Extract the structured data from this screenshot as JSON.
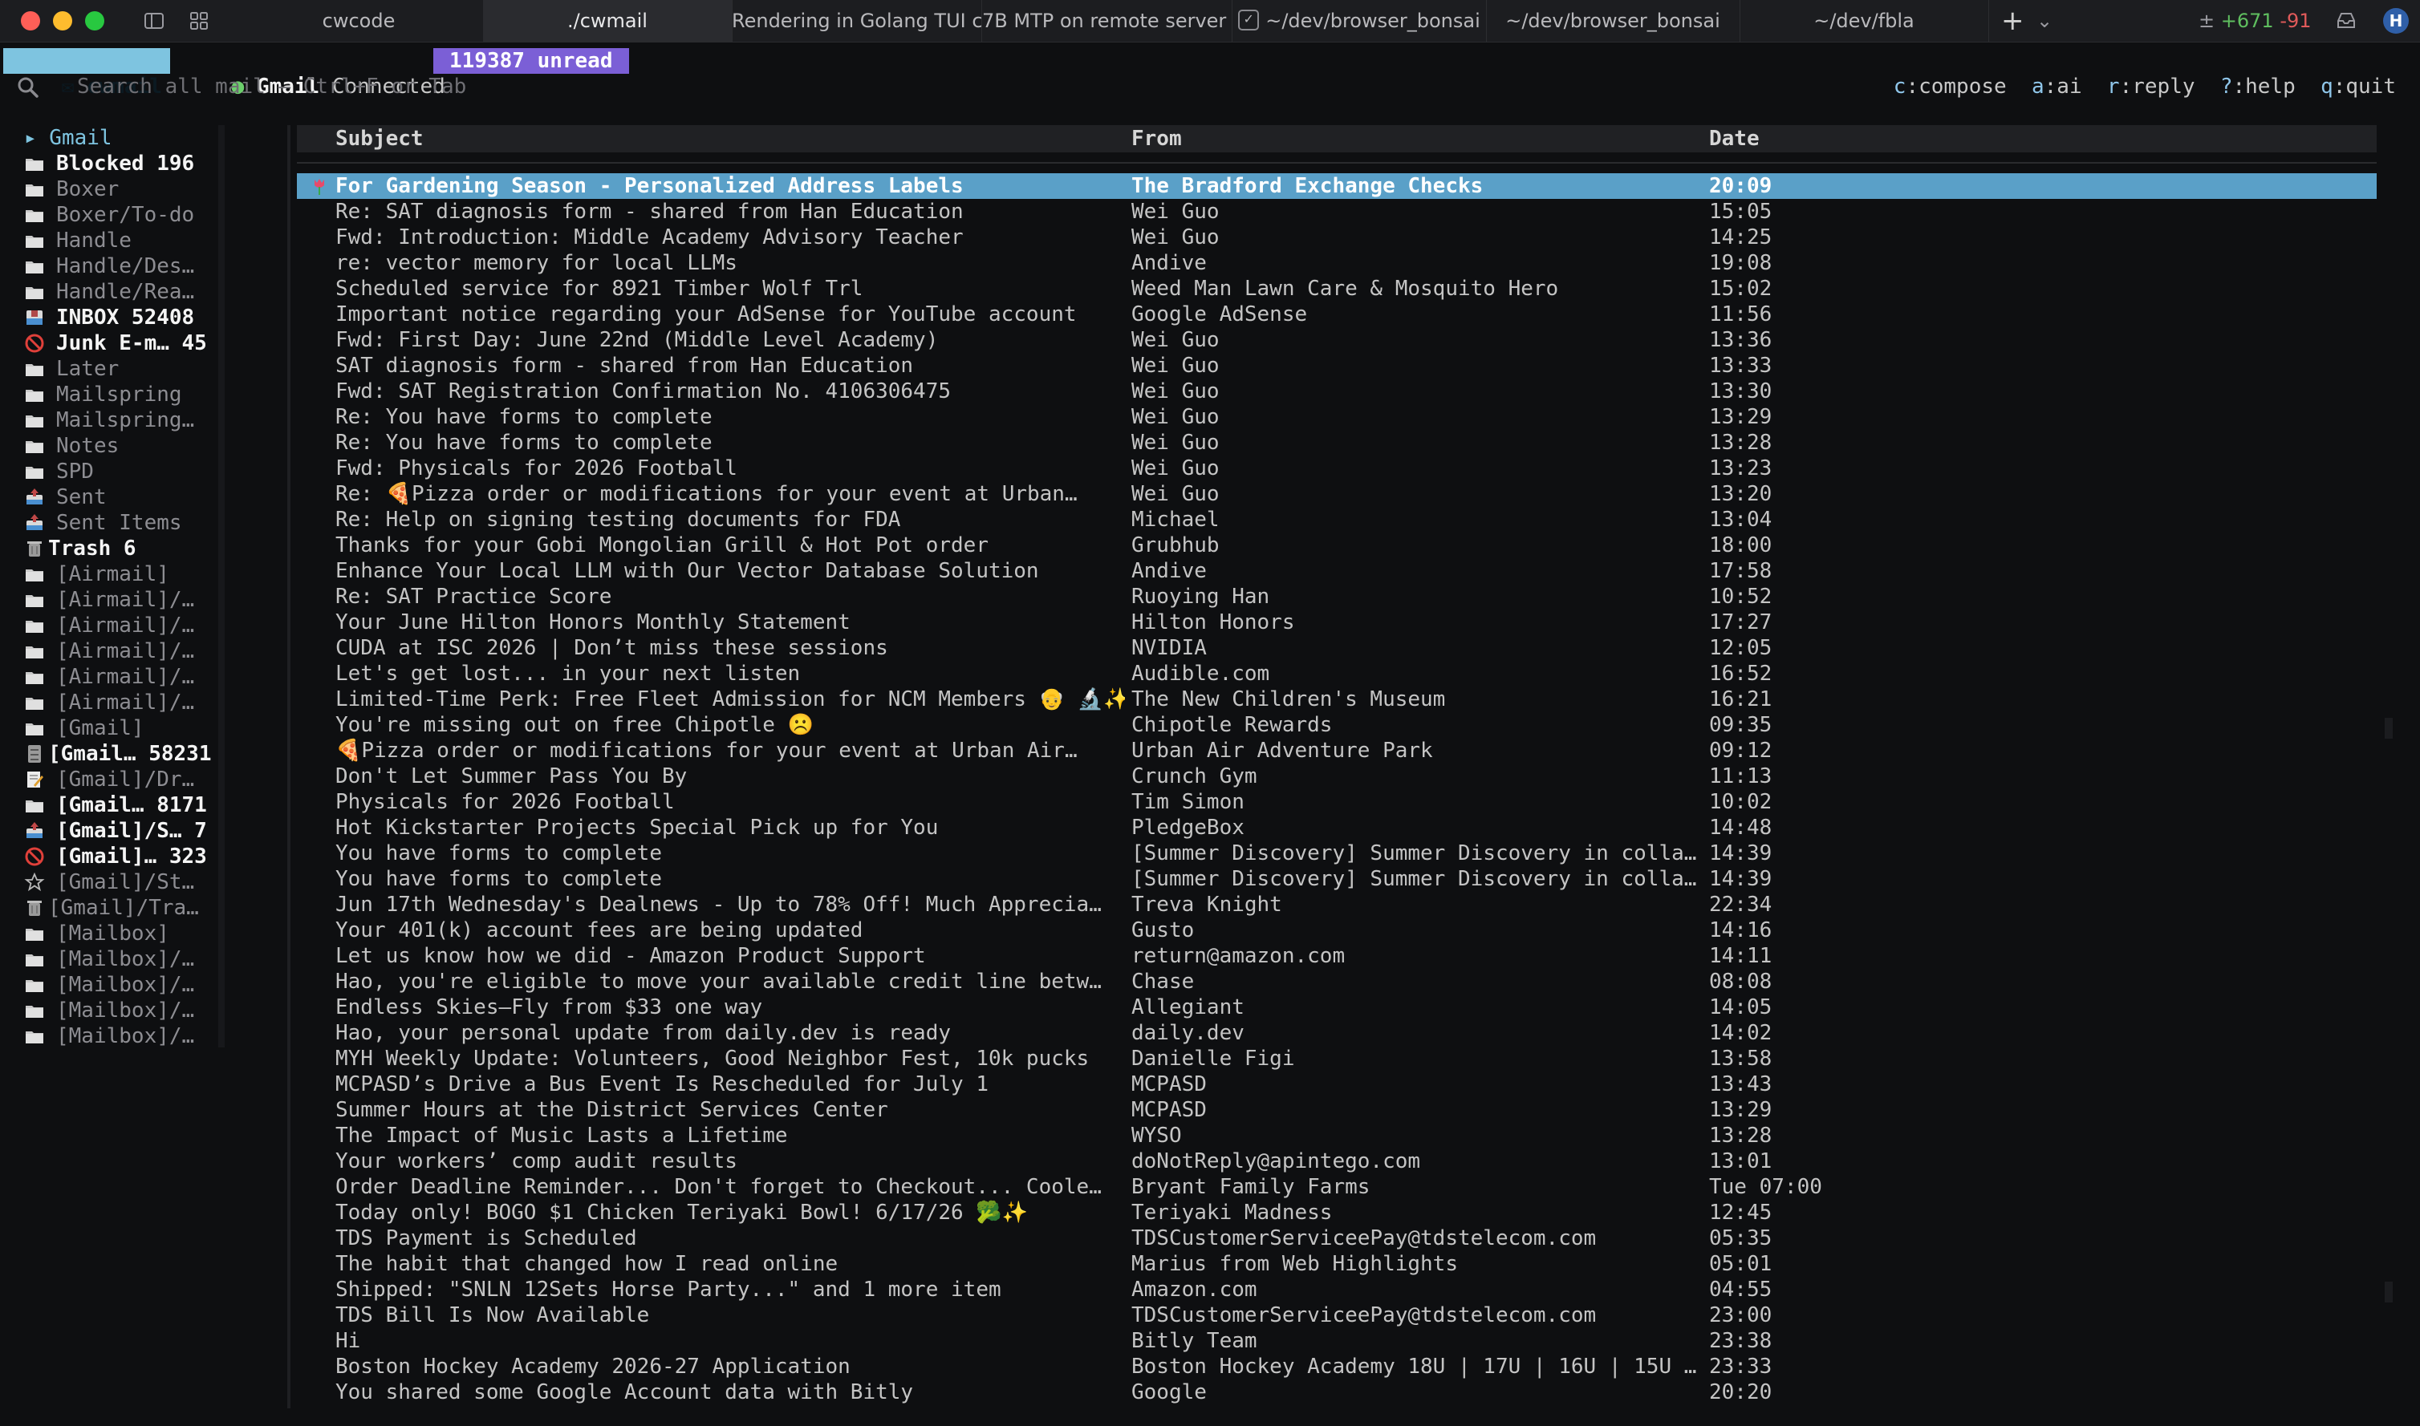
{
  "titlebar": {
    "tabs": [
      {
        "label": "cwcode",
        "active": false
      },
      {
        "label": "./cwmail",
        "active": true
      },
      {
        "label": "Rendering in Golang TUI client",
        "active": false
      },
      {
        "label": "7B MTP on remote server",
        "active": false
      },
      {
        "label": "~/dev/browser_bonsai",
        "active": false,
        "checkbox": true
      },
      {
        "label": "~/dev/browser_bonsai",
        "active": false
      },
      {
        "label": "~/dev/fbla",
        "active": false
      }
    ],
    "new_tab": "+",
    "diff_added": "+671",
    "diff_removed": "-91",
    "avatar": "H"
  },
  "status": {
    "app_name": "cwmail",
    "account": "Gmail",
    "connection": "Connected",
    "unread": "119387 unread",
    "shortcuts": [
      {
        "key": "c",
        "action": ":compose"
      },
      {
        "key": "a",
        "action": ":ai"
      },
      {
        "key": "r",
        "action": ":reply"
      },
      {
        "key": "?",
        "action": ":help"
      },
      {
        "key": "q",
        "action": ":quit"
      }
    ]
  },
  "search": {
    "placeholder": "Search all mail — Ctrl+F or Tab"
  },
  "sidebar": {
    "account": "▸ Gmail",
    "folders": [
      {
        "label": "Blocked 196",
        "icon": "folder",
        "bold": true
      },
      {
        "label": "Boxer",
        "icon": "folder"
      },
      {
        "label": "Boxer/To-do",
        "icon": "folder"
      },
      {
        "label": "Handle",
        "icon": "folder"
      },
      {
        "label": "Handle/Des…",
        "icon": "folder"
      },
      {
        "label": "Handle/Rea…",
        "icon": "folder"
      },
      {
        "label": "INBOX 52408",
        "icon": "inbox",
        "bold": true
      },
      {
        "label": "Junk E-m… 45",
        "icon": "junk",
        "bold": true
      },
      {
        "label": "Later",
        "icon": "folder"
      },
      {
        "label": "Mailspring",
        "icon": "folder"
      },
      {
        "label": "Mailspring…",
        "icon": "folder"
      },
      {
        "label": "Notes",
        "icon": "folder"
      },
      {
        "label": "SPD",
        "icon": "folder"
      },
      {
        "label": "Sent",
        "icon": "sent"
      },
      {
        "label": "Sent Items",
        "icon": "sent"
      },
      {
        "label": "Trash      6",
        "icon": "trash",
        "bold": true
      },
      {
        "label": "[Airmail]",
        "icon": "folder"
      },
      {
        "label": "[Airmail]/…",
        "icon": "folder"
      },
      {
        "label": "[Airmail]/…",
        "icon": "folder"
      },
      {
        "label": "[Airmail]/…",
        "icon": "folder"
      },
      {
        "label": "[Airmail]/…",
        "icon": "folder"
      },
      {
        "label": "[Airmail]/…",
        "icon": "folder"
      },
      {
        "label": "[Gmail]",
        "icon": "folder"
      },
      {
        "label": "[Gmail… 58231",
        "icon": "archive",
        "bold": true
      },
      {
        "label": "[Gmail]/Dr…",
        "icon": "draft"
      },
      {
        "label": "[Gmail… 8171",
        "icon": "folder",
        "bold": true
      },
      {
        "label": "[Gmail]/S… 7",
        "icon": "sent",
        "bold": true
      },
      {
        "label": "[Gmail]… 323",
        "icon": "junk",
        "bold": true
      },
      {
        "label": "[Gmail]/St…",
        "icon": "star"
      },
      {
        "label": "[Gmail]/Tra…",
        "icon": "trash"
      },
      {
        "label": "[Mailbox]",
        "icon": "folder"
      },
      {
        "label": "[Mailbox]/…",
        "icon": "folder"
      },
      {
        "label": "[Mailbox]/…",
        "icon": "folder"
      },
      {
        "label": "[Mailbox]/…",
        "icon": "folder"
      },
      {
        "label": "[Mailbox]/…",
        "icon": "folder"
      }
    ]
  },
  "table": {
    "headers": {
      "subject": "Subject",
      "from": "From",
      "date": "Date"
    },
    "rows": [
      {
        "subject": "For Gardening Season - Personalized Address Labels",
        "from": "The Bradford Exchange Checks",
        "date": "20:09",
        "selected": true,
        "marker": "tulip"
      },
      {
        "subject": "Re: SAT diagnosis form - shared from Han Education",
        "from": "Wei Guo",
        "date": "15:05"
      },
      {
        "subject": "Fwd: Introduction: Middle Academy Advisory Teacher",
        "from": "Wei Guo",
        "date": "14:25"
      },
      {
        "subject": "re: vector memory for local LLMs",
        "from": "Andive",
        "date": "19:08"
      },
      {
        "subject": "Scheduled service for 8921 Timber Wolf Trl",
        "from": "Weed Man Lawn Care & Mosquito Hero",
        "date": "15:02"
      },
      {
        "subject": "Important notice regarding your AdSense for YouTube account",
        "from": "Google AdSense",
        "date": "11:56"
      },
      {
        "subject": "Fwd: First Day: June 22nd (Middle Level Academy)",
        "from": "Wei Guo",
        "date": "13:36"
      },
      {
        "subject": "SAT diagnosis form - shared from Han Education",
        "from": "Wei Guo",
        "date": "13:33"
      },
      {
        "subject": "Fwd: SAT Registration Confirmation No. 4106306475",
        "from": "Wei Guo",
        "date": "13:30"
      },
      {
        "subject": "Re: You have forms to complete",
        "from": "Wei Guo",
        "date": "13:29"
      },
      {
        "subject": "Re: You have forms to complete",
        "from": "Wei Guo",
        "date": "13:28"
      },
      {
        "subject": "Fwd: Physicals for 2026 Football",
        "from": "Wei Guo",
        "date": "13:23"
      },
      {
        "subject": "Re: 🍕Pizza order or modifications for your event at Urban…",
        "from": "Wei Guo",
        "date": "13:20"
      },
      {
        "subject": "Re: Help on signing testing documents for FDA",
        "from": "Michael",
        "date": "13:04"
      },
      {
        "subject": "Thanks for your Gobi Mongolian Grill & Hot Pot order",
        "from": "Grubhub",
        "date": "18:00"
      },
      {
        "subject": "Enhance Your Local LLM with Our Vector Database Solution",
        "from": "Andive",
        "date": "17:58"
      },
      {
        "subject": "Re: SAT Practice Score",
        "from": "Ruoying Han",
        "date": "10:52"
      },
      {
        "subject": "Your June Hilton Honors Monthly Statement",
        "from": "Hilton Honors",
        "date": "17:27"
      },
      {
        "subject": "CUDA at ISC 2026 | Don’t miss these sessions",
        "from": "NVIDIA",
        "date": "12:05"
      },
      {
        "subject": "Let's get lost... in your next listen",
        "from": "Audible.com",
        "date": "16:52"
      },
      {
        "subject": "Limited-Time Perk: Free Fleet Admission for NCM Members 👴 🔬✨",
        "from": "The New Children's Museum",
        "date": "16:21"
      },
      {
        "subject": "You're missing out on free Chipotle ☹️",
        "from": "Chipotle Rewards",
        "date": "09:35"
      },
      {
        "subject": "🍕Pizza order or modifications for your event at Urban Air…",
        "from": "Urban Air Adventure Park",
        "date": "09:12"
      },
      {
        "subject": "Don't Let Summer Pass You By",
        "from": "Crunch Gym",
        "date": "11:13"
      },
      {
        "subject": "Physicals for 2026 Football",
        "from": "Tim Simon",
        "date": "10:02"
      },
      {
        "subject": "Hot Kickstarter Projects Special Pick up for You",
        "from": "PledgeBox",
        "date": "14:48"
      },
      {
        "subject": "You have forms to complete",
        "from": "[Summer Discovery] Summer Discovery in colla…",
        "date": "14:39"
      },
      {
        "subject": "You have forms to complete",
        "from": "[Summer Discovery] Summer Discovery in colla…",
        "date": "14:39"
      },
      {
        "subject": "Jun 17th Wednesday's Dealnews - Up to 78% Off! Much Apprecia…",
        "from": "Treva Knight",
        "date": "22:34"
      },
      {
        "subject": "Your 401(k) account fees are being updated",
        "from": "Gusto",
        "date": "14:16"
      },
      {
        "subject": "Let us know how we did - Amazon Product Support",
        "from": "return@amazon.com",
        "date": "14:11"
      },
      {
        "subject": "Hao, you're eligible to move your available credit line betw…",
        "from": "Chase",
        "date": "08:08"
      },
      {
        "subject": "Endless Skies—Fly from $33 one way",
        "from": "Allegiant",
        "date": "14:05"
      },
      {
        "subject": "Hao, your personal update from daily.dev is ready",
        "from": "daily.dev",
        "date": "14:02"
      },
      {
        "subject": "MYH Weekly Update: Volunteers, Good Neighbor Fest, 10k pucks",
        "from": "Danielle Figi",
        "date": "13:58"
      },
      {
        "subject": "MCPASD’s Drive a Bus Event Is Rescheduled for July 1",
        "from": "MCPASD",
        "date": "13:43"
      },
      {
        "subject": "Summer Hours at the District Services Center",
        "from": "MCPASD",
        "date": "13:29"
      },
      {
        "subject": "The Impact of Music Lasts a Lifetime",
        "from": "WYSO",
        "date": "13:28"
      },
      {
        "subject": "Your workers’ comp audit results",
        "from": "doNotReply@apintego.com",
        "date": "13:01"
      },
      {
        "subject": "Order Deadline Reminder... Don't forget to Checkout... Coole…",
        "from": "Bryant Family Farms",
        "date": "Tue 07:00"
      },
      {
        "subject": "Today only! BOGO $1 Chicken Teriyaki Bowl! 6/17/26 🥦✨",
        "from": "Teriyaki Madness",
        "date": "12:45"
      },
      {
        "subject": "TDS Payment is Scheduled",
        "from": "TDSCustomerServiceePay@tdstelecom.com",
        "date": "05:35"
      },
      {
        "subject": "The habit that changed how I read online",
        "from": "Marius from Web Highlights",
        "date": "05:01"
      },
      {
        "subject": "Shipped: \"SNLN 12Sets Horse Party...\" and 1 more item",
        "from": "Amazon.com",
        "date": "04:55"
      },
      {
        "subject": "TDS Bill Is Now Available",
        "from": "TDSCustomerServiceePay@tdstelecom.com",
        "date": "23:00"
      },
      {
        "subject": "Hi",
        "from": "Bitly Team",
        "date": "23:38"
      },
      {
        "subject": "Boston Hockey Academy 2026-27 Application",
        "from": "Boston Hockey Academy 18U | 17U | 16U | 15U …",
        "date": "23:33"
      },
      {
        "subject": "You shared some Google Account data with Bitly",
        "from": "Google",
        "date": "20:20"
      }
    ]
  },
  "colors": {
    "accent": "#7ec4e0",
    "selected_row": "#5aa0c8",
    "unread_badge": "#7b5fd6",
    "connected": "#6ccf6c"
  }
}
